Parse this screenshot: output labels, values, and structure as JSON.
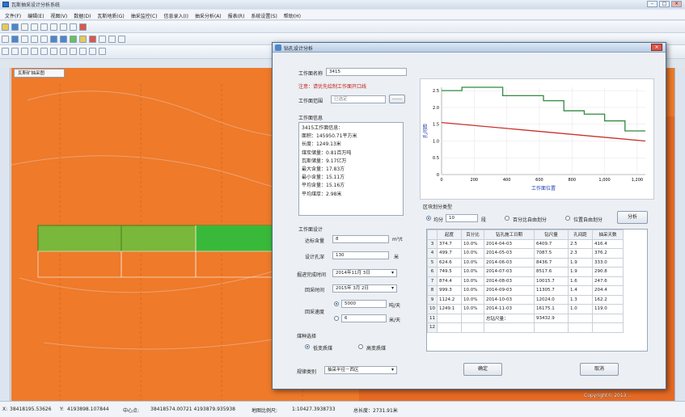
{
  "app": {
    "title": "瓦斯抽采设计分析系统"
  },
  "menu": [
    "文件(F)",
    "编辑(E)",
    "视图(V)",
    "数据(D)",
    "瓦斯地质(G)",
    "抽采监控(C)",
    "信息录入(I)",
    "抽采分析(A)",
    "报表(R)",
    "系统设置(S)",
    "帮助(H)"
  ],
  "map": {
    "tab_label": "瓦斯矿抽采图",
    "copyright": "Copyright© 2013 ..."
  },
  "status": {
    "coord_x_label": "X:",
    "coord_x": "38418195.53626",
    "coord_y_label": "Y:",
    "coord_y": "4193898.107844",
    "center_label": "中心点:",
    "center": "38418574.00721  4193879.935938",
    "scale_label": "地图比例尺:",
    "scale": "1:10427.3938733",
    "total_length": "总长度：2731.91米"
  },
  "dialog": {
    "title": "钻孔设计分析",
    "face_name_label": "工作面名称",
    "face_name": "3415",
    "note": "注意：请优先绘制工作面开口线",
    "face_range_label": "工作面范围",
    "face_range": "已选定",
    "browse_label": "……",
    "face_info_label": "工作面信息",
    "face_info_lines": [
      "3415工作面信息：",
      "面积：145950.71平方米",
      "长度：1249.13米",
      "煤炭储量：0.81百万吨",
      "瓦斯储量：9.17亿万",
      "最大含量：17.83方",
      "最小含量：15.11方",
      "平均含量：15.16方",
      "平均煤厚：2.98米"
    ],
    "design_label": "工作面设计",
    "target_content_label": "达标含量",
    "target_content": "8",
    "target_content_unit": "m³/t",
    "hole_depth_label": "设计孔深",
    "hole_depth": "130",
    "hole_depth_unit": "米",
    "finish_time_label": "掘进完成时间",
    "finish_time": "2014年11月 3日",
    "mining_time_label": "回采时间",
    "mining_time": "2015年 3月 2日",
    "speed_label": "回采速度",
    "speed_1": "5000",
    "speed_1_unit": "吨/天",
    "speed_2": "6",
    "speed_2_unit": "米/天",
    "coal_label": "煤种选择",
    "coal_low": "低变质煤",
    "coal_mid": "高变质煤",
    "pattern_label": "规律类别",
    "pattern": "抽采半径－西区",
    "section_label": "区块划分类型",
    "opt_equal": "均分",
    "equal_count": "10",
    "equal_unit": "段",
    "opt_percent": "百分比自由划分",
    "opt_position": "位置自由划分",
    "split_button": "分析",
    "confirm_button": "确定",
    "cancel_button": "取消"
  },
  "chart_data": {
    "type": "line",
    "xlabel": "工作面位置",
    "ylabel": "孔间距",
    "xlim": [
      0,
      1250
    ],
    "ylim": [
      0,
      2.6
    ],
    "xticks": [
      "0",
      "200",
      "400",
      "600",
      "800",
      "1,000",
      "1,200"
    ],
    "yticks": [
      "0",
      "0.5",
      "1.0",
      "1.5",
      "2.0",
      "2.5"
    ],
    "series": [
      {
        "color": "#2e8b3e",
        "points": [
          [
            0,
            2.5
          ],
          [
            125,
            2.5
          ],
          [
            125,
            2.6
          ],
          [
            375,
            2.6
          ],
          [
            375,
            2.35
          ],
          [
            625,
            2.35
          ],
          [
            625,
            2.2
          ],
          [
            750,
            2.2
          ],
          [
            750,
            1.9
          ],
          [
            875,
            1.9
          ],
          [
            875,
            1.8
          ],
          [
            1000,
            1.8
          ],
          [
            1000,
            1.6
          ],
          [
            1125,
            1.6
          ],
          [
            1125,
            1.3
          ],
          [
            1250,
            1.3
          ]
        ]
      },
      {
        "color": "#c8322c",
        "points": [
          [
            0,
            1.55
          ],
          [
            1250,
            1.0
          ]
        ]
      }
    ]
  },
  "table": {
    "headers": [
      "",
      "起度",
      "百分比",
      "钻孔施工日期",
      "钻尺量",
      "孔间距",
      "抽采天数"
    ],
    "rows": [
      [
        "3",
        "374.7",
        "10.0%",
        "2014-04-03",
        "6409.7",
        "2.5",
        "416.4"
      ],
      [
        "4",
        "499.7",
        "10.0%",
        "2014-05-03",
        "7087.5",
        "2.3",
        "376.2"
      ],
      [
        "5",
        "624.6",
        "10.0%",
        "2014-06-03",
        "8436.7",
        "1.9",
        "333.0"
      ],
      [
        "6",
        "749.5",
        "10.0%",
        "2014-07-03",
        "8517.6",
        "1.9",
        "290.8"
      ],
      [
        "7",
        "874.4",
        "10.0%",
        "2014-08-03",
        "10015.7",
        "1.6",
        "247.6"
      ],
      [
        "8",
        "999.3",
        "10.0%",
        "2014-09-03",
        "11305.7",
        "1.4",
        "204.4"
      ],
      [
        "9",
        "1124.2",
        "10.0%",
        "2014-10-03",
        "12024.0",
        "1.3",
        "162.2"
      ],
      [
        "10",
        "1249.1",
        "10.0%",
        "2014-11-03",
        "16175.1",
        "1.0",
        "119.0"
      ],
      [
        "11",
        "",
        "",
        "总钻尺量：",
        "93432.9",
        "",
        ""
      ],
      [
        "12",
        "",
        "",
        "",
        "",
        "",
        ""
      ]
    ]
  }
}
